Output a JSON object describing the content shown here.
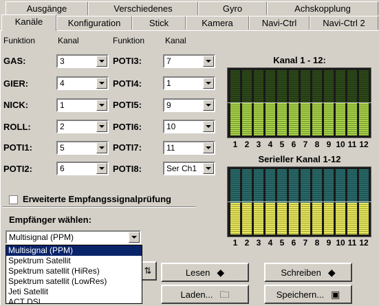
{
  "tabs_row1": [
    {
      "label": "Ausgänge"
    },
    {
      "label": "Verschiedenes"
    },
    {
      "label": "Gyro"
    },
    {
      "label": "Achskopplung"
    }
  ],
  "tabs_row2": [
    {
      "label": "Kanäle",
      "active": true
    },
    {
      "label": "Konfiguration"
    },
    {
      "label": "Stick"
    },
    {
      "label": "Kamera"
    },
    {
      "label": "Navi-Ctrl"
    },
    {
      "label": "Navi-Ctrl 2"
    }
  ],
  "headers": {
    "funktion1": "Funktion",
    "kanal1": "Kanal",
    "funktion2": "Funktion",
    "kanal2": "Kanal"
  },
  "left_rows": [
    {
      "label": "GAS:",
      "value": "3"
    },
    {
      "label": "GIER:",
      "value": "4"
    },
    {
      "label": "NICK:",
      "value": "1"
    },
    {
      "label": "ROLL:",
      "value": "2"
    },
    {
      "label": "POTI1:",
      "value": "5"
    },
    {
      "label": "POTI2:",
      "value": "6"
    }
  ],
  "right_rows": [
    {
      "label": "POTI3:",
      "value": "7"
    },
    {
      "label": "POTI4:",
      "value": "1"
    },
    {
      "label": "POTI5:",
      "value": "9"
    },
    {
      "label": "POTI6:",
      "value": "10"
    },
    {
      "label": "POTI7:",
      "value": "11"
    },
    {
      "label": "POTI8:",
      "value": "Ser Ch1"
    }
  ],
  "checkbox": {
    "label": "Erweiterte Empfangssignalprüfung",
    "checked": false
  },
  "receiver": {
    "title": "Empfänger wählen:",
    "selected": "Multisignal (PPM)"
  },
  "receiver_options": [
    "Multisignal (PPM)",
    "Spektrum Satellit",
    "Spektrum satellit (HiRes)",
    "Spektrum satellit (LowRes)",
    "Jeti Satellit",
    "ACT DSL"
  ],
  "graph1": {
    "title": "Kanal 1 - 12:",
    "channel_numbers": [
      "1",
      "2",
      "3",
      "4",
      "5",
      "6",
      "7",
      "8",
      "9",
      "10",
      "11",
      "12"
    ]
  },
  "graph2": {
    "title": "Serieller Kanal 1-12",
    "channel_numbers": [
      "1",
      "2",
      "3",
      "4",
      "5",
      "6",
      "7",
      "8",
      "9",
      "10",
      "11",
      "12"
    ]
  },
  "buttons": {
    "lesen": "Lesen",
    "schreiben": "Schreiben",
    "laden": "Laden...",
    "speichern": "Speichern..."
  },
  "colors": {
    "bar_green": "#9acd32",
    "bar_dark": "#2e4a1a",
    "bar_cyan": "#4ac8c8",
    "bar_yellow": "#e8e860"
  }
}
